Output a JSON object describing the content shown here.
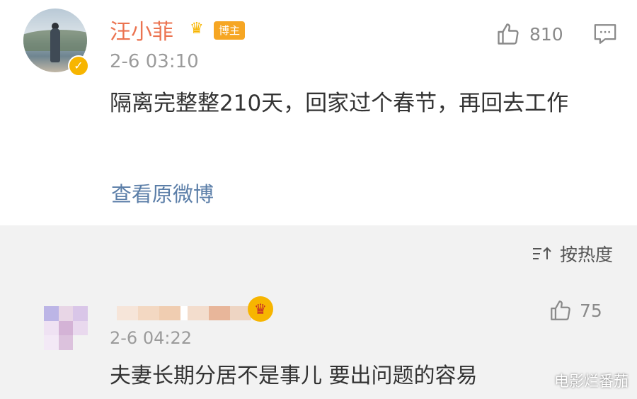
{
  "post": {
    "username": "汪小菲",
    "tag": "博主",
    "time": "2-6 03:10",
    "content": "隔离完整整210天，回家过个春节，再回去工作",
    "view_link": "查看原微博",
    "likes": "810",
    "icons": [
      "avatar",
      "verified-badge-icon",
      "crown-icon",
      "thumbs-up-icon",
      "comment-icon"
    ]
  },
  "sort": {
    "label": "按热度",
    "icon": "sort-icon"
  },
  "reply": {
    "time": "2-6 04:22",
    "content": "夫妻长期分居不是事儿 要出问题的容易",
    "likes": "75",
    "username_blurred": true
  },
  "watermark": "电影烂番茄",
  "colors": {
    "username": "#eb7350",
    "link": "#5b7ea8",
    "badge": "#f7b500",
    "tag": "#f6a623",
    "secondary_text": "#9b9b9b",
    "reply_bg": "#f2f2f2"
  }
}
